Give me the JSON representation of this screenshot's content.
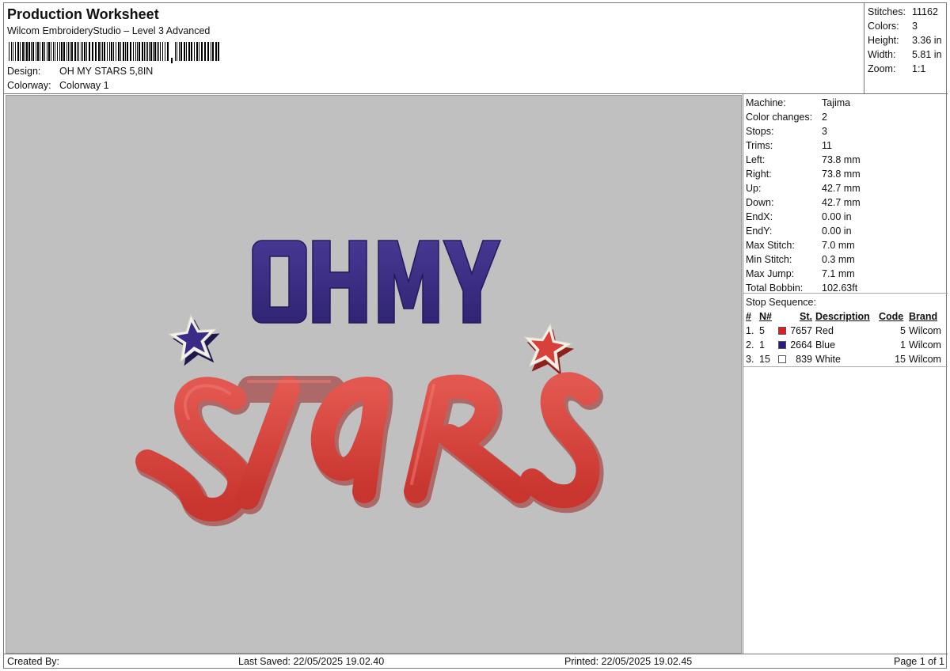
{
  "header": {
    "title": "Production Worksheet",
    "subtitle": "Wilcom EmbroideryStudio – Level 3 Advanced",
    "design_label": "Design:",
    "design_value": "OH MY STARS 5,8IN",
    "colorway_label": "Colorway:",
    "colorway_value": "Colorway 1"
  },
  "summary": [
    {
      "label": "Stitches:",
      "value": "11162"
    },
    {
      "label": "Colors:",
      "value": "3"
    },
    {
      "label": "Height:",
      "value": "3.36 in"
    },
    {
      "label": "Width:",
      "value": "5.81 in"
    },
    {
      "label": "Zoom:",
      "value": "1:1"
    }
  ],
  "machine_stats": [
    {
      "label": "Machine:",
      "value": "Tajima"
    },
    {
      "label": "Color changes:",
      "value": "2"
    },
    {
      "label": "Stops:",
      "value": "3"
    },
    {
      "label": "Trims:",
      "value": "11"
    },
    {
      "label": "Left:",
      "value": "73.8 mm"
    },
    {
      "label": "Right:",
      "value": "73.8 mm"
    },
    {
      "label": "Up:",
      "value": "42.7 mm"
    },
    {
      "label": "Down:",
      "value": "42.7 mm"
    },
    {
      "label": "EndX:",
      "value": "0.00 in"
    },
    {
      "label": "EndY:",
      "value": "0.00 in"
    },
    {
      "label": "Max Stitch:",
      "value": "7.0 mm"
    },
    {
      "label": "Min Stitch:",
      "value": "0.3 mm"
    },
    {
      "label": "Max Jump:",
      "value": "7.1 mm"
    },
    {
      "label": "Total Bobbin:",
      "value": "102.63ft"
    }
  ],
  "stop_sequence": {
    "title": "Stop Sequence:",
    "headers": [
      "#",
      "N#",
      "St.",
      "Description",
      "Code",
      "Brand"
    ],
    "rows": [
      {
        "idx": "1.",
        "n": "5",
        "color": "#e02020",
        "st": "7657",
        "desc": "Red",
        "code": "5",
        "brand": "Wilcom"
      },
      {
        "idx": "2.",
        "n": "1",
        "color": "#2a1a80",
        "st": "2664",
        "desc": "Blue",
        "code": "1",
        "brand": "Wilcom"
      },
      {
        "idx": "3.",
        "n": "15",
        "color": "#ffffff",
        "st": "839",
        "desc": "White",
        "code": "15",
        "brand": "Wilcom"
      }
    ]
  },
  "design_preview": {
    "line1": "OH MY",
    "line2": "STARS",
    "colors": {
      "blue": "#3b2d84",
      "red": "#d9403a",
      "white": "#f4f1ea",
      "background": "#c0c0c0"
    }
  },
  "footer": {
    "created_by": "Created By:",
    "last_saved": "Last Saved: 22/05/2025 19.02.40",
    "printed": "Printed: 22/05/2025 19.02.45",
    "page": "Page 1 of 1"
  }
}
